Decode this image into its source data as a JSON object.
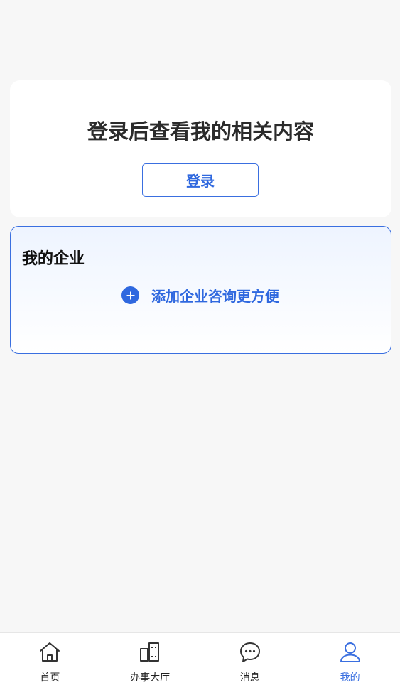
{
  "login_card": {
    "title": "登录后查看我的相关内容",
    "login_button": "登录"
  },
  "enterprise": {
    "title": "我的企业",
    "add_label": "添加企业咨询更方便",
    "add_icon": "plus-circle-icon"
  },
  "tabbar": {
    "active": "我的",
    "accent_color": "#3a6fe0",
    "items": [
      {
        "label": "首页",
        "icon": "home-icon"
      },
      {
        "label": "办事大厅",
        "icon": "building-icon"
      },
      {
        "label": "消息",
        "icon": "chat-icon"
      },
      {
        "label": "我的",
        "icon": "user-icon"
      }
    ]
  }
}
